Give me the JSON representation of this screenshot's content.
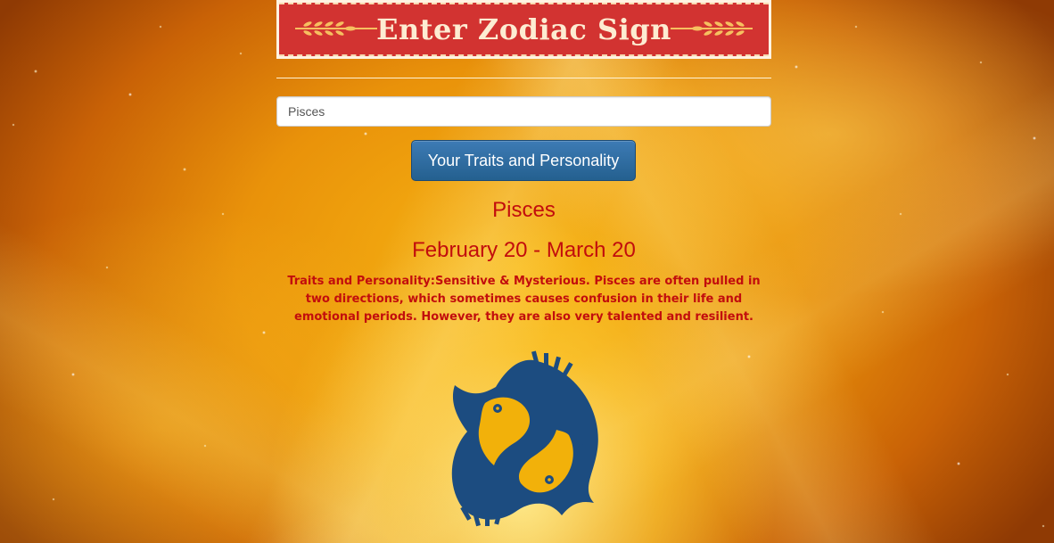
{
  "banner": {
    "title": "Enter Zodiac Sign"
  },
  "search": {
    "value": "Pisces"
  },
  "actions": {
    "traits_button_label": "Your Traits and Personality"
  },
  "result": {
    "sign": "Pisces",
    "dates": "February 20 - March 20",
    "description": "Traits and Personality:Sensitive & Mysterious. Pisces are often pulled in two directions, which sometimes causes confusion in their life and emotional periods. However, they are also very talented and resilient.",
    "symbol_icon": "pisces-symbol-icon"
  },
  "colors": {
    "banner_red": "#d23331",
    "text_red": "#c20d0d",
    "button_blue": "#2a6496",
    "symbol_blue": "#1c4c80",
    "symbol_fill": "#f2b10a"
  }
}
